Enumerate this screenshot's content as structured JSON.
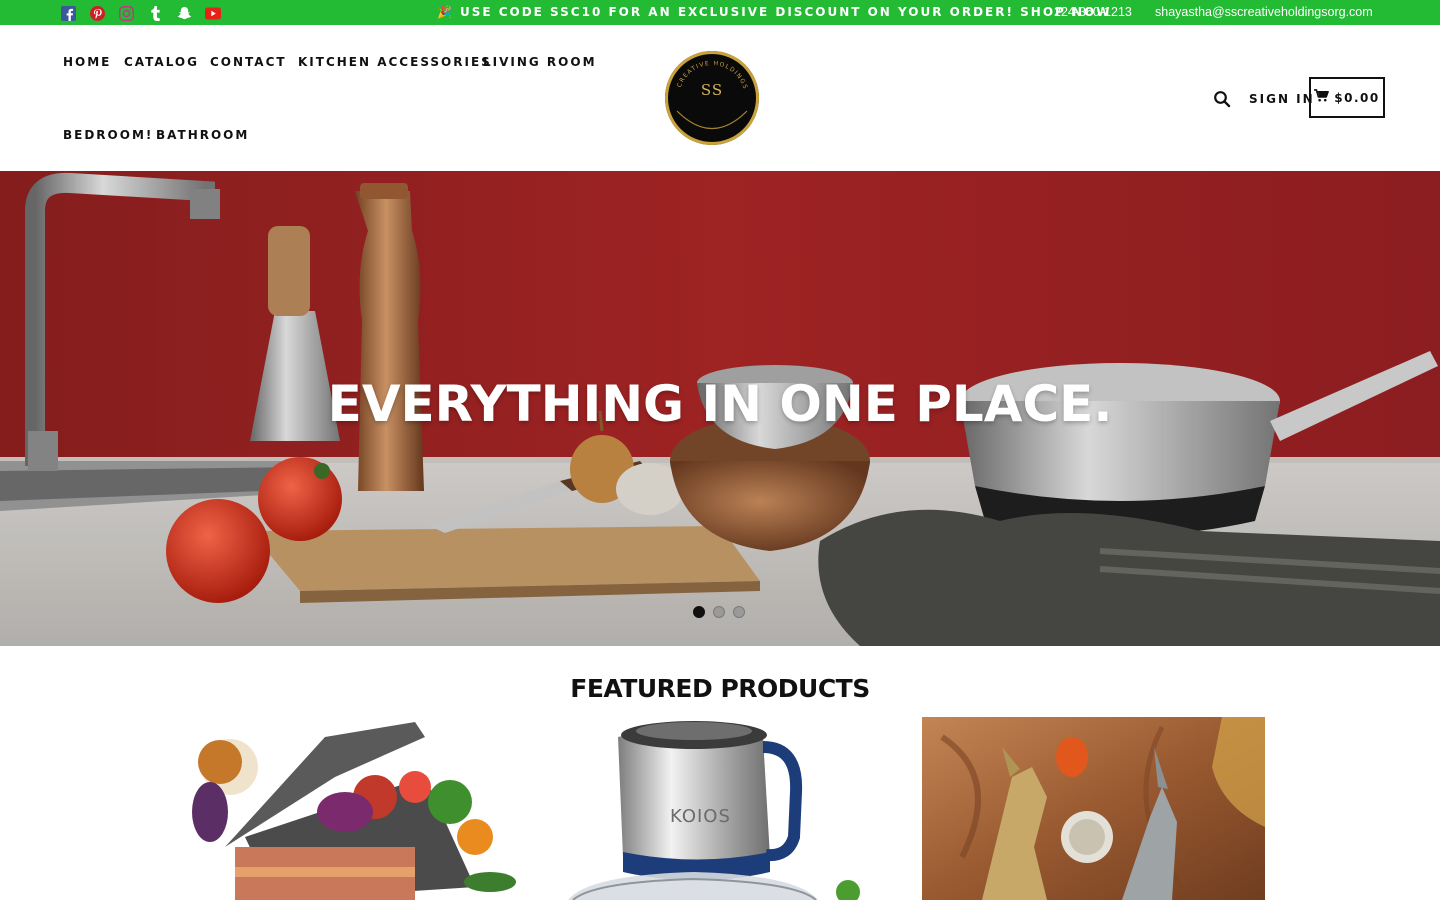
{
  "topbar": {
    "bg_color": "#22bb33",
    "social": [
      {
        "name": "facebook-icon",
        "color": "#3b5998"
      },
      {
        "name": "pinterest-icon",
        "color": "#cb2027"
      },
      {
        "name": "instagram-icon",
        "color": "#c13584"
      },
      {
        "name": "tumblr-icon",
        "color": "#ffffff"
      },
      {
        "name": "snapchat-icon",
        "color": "#ffffff"
      },
      {
        "name": "youtube-icon",
        "color": "#e62117"
      }
    ],
    "promo_emoji": "🎉",
    "promo_text": "USE CODE SSC10 FOR AN EXCLUSIVE DISCOUNT ON YOUR ORDER! SHOP NOW",
    "phone": "224-360-1213",
    "email": "shayastha@sscreativeholdingsorg.com"
  },
  "nav": {
    "items": [
      "HOME",
      "CATALOG",
      "CONTACT",
      "KITCHEN ACCESSORIES",
      "LIVING ROOM",
      "BEDROOM!",
      "BATHROOM"
    ],
    "sign_in": "SIGN IN",
    "cart_total": "$0.00"
  },
  "logo": {
    "monogram": "SS",
    "ring_text": "CREATIVE HOLDINGS",
    "accent_color": "#c9a23a"
  },
  "hero": {
    "title": "EVERYTHING IN ONE PLACE.",
    "slides": 3,
    "active_slide": 1
  },
  "featured": {
    "title": "FEATURED PRODUCTS",
    "products": [
      {
        "name": "vegetable-chopper-image"
      },
      {
        "name": "food-processor-image",
        "brand_text": "KOIOS"
      },
      {
        "name": "fish-bottle-opener-image"
      }
    ]
  }
}
